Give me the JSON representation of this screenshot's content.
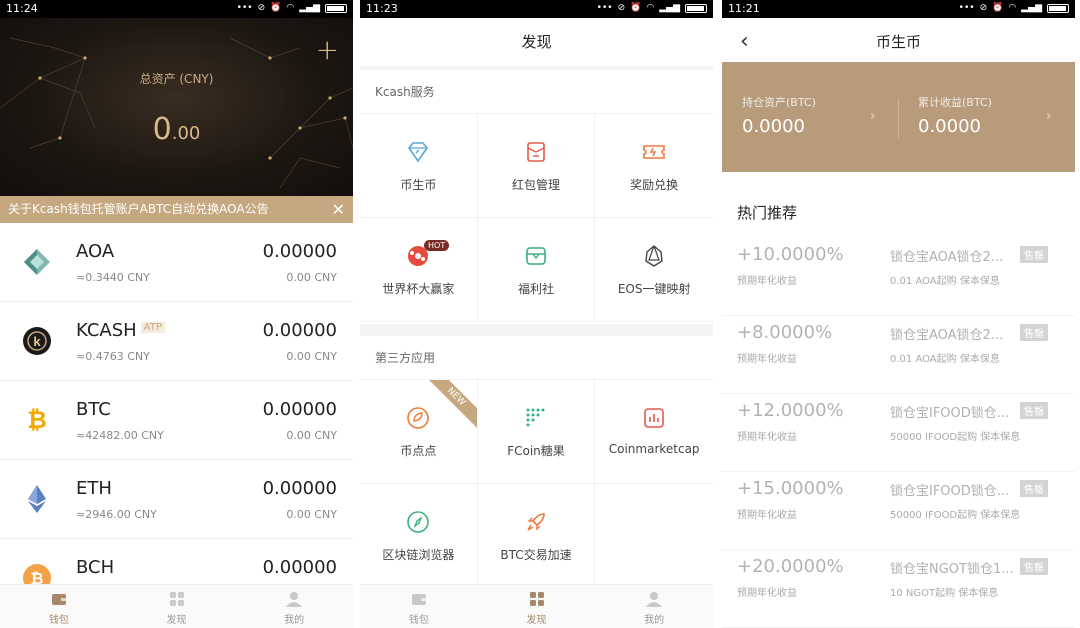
{
  "screen1": {
    "status_time": "11:24",
    "asset_label": "总资产 (CNY)",
    "asset_value_int": "0",
    "asset_value_dec": ".00",
    "notice": "关于Kcash钱包托管账户ABTC自动兑换AOA公告",
    "coins": [
      {
        "name": "AOA",
        "badge": "",
        "price": "≈0.3440 CNY",
        "amount": "0.00000",
        "cny": "0.00 CNY",
        "icon": "aoa-icon"
      },
      {
        "name": "KCASH",
        "badge": "ATP",
        "price": "≈0.4763 CNY",
        "amount": "0.00000",
        "cny": "0.00 CNY",
        "icon": "kcash-icon"
      },
      {
        "name": "BTC",
        "badge": "",
        "price": "≈42482.00 CNY",
        "amount": "0.00000",
        "cny": "0.00 CNY",
        "icon": "btc-icon"
      },
      {
        "name": "ETH",
        "badge": "",
        "price": "≈2946.00 CNY",
        "amount": "0.00000",
        "cny": "0.00 CNY",
        "icon": "eth-icon"
      },
      {
        "name": "BCH",
        "badge": "",
        "price": "",
        "amount": "0.00000",
        "cny": "",
        "icon": "bch-icon"
      }
    ],
    "tabs": [
      "钱包",
      "发现",
      "我的"
    ],
    "active_tab": 0
  },
  "screen2": {
    "status_time": "11:23",
    "title": "发现",
    "section1_title": "Kcash服务",
    "section1_items": [
      {
        "label": "币生币",
        "icon": "diamond-icon"
      },
      {
        "label": "红包管理",
        "icon": "red-envelope-icon"
      },
      {
        "label": "奖励兑换",
        "icon": "ticket-icon"
      },
      {
        "label": "世界杯大赢家",
        "icon": "soccer-ball-icon",
        "badge": "HOT"
      },
      {
        "label": "福利社",
        "icon": "gift-box-icon"
      },
      {
        "label": "EOS一键映射",
        "icon": "eos-icon"
      }
    ],
    "section2_title": "第三方应用",
    "section2_items": [
      {
        "label": "币点点",
        "icon": "coin-dot-icon",
        "ribbon": "NEW"
      },
      {
        "label": "FCoin糖果",
        "icon": "fcoin-icon"
      },
      {
        "label": "Coinmarketcap",
        "icon": "chart-icon"
      },
      {
        "label": "区块链浏览器",
        "icon": "compass-icon"
      },
      {
        "label": "BTC交易加速",
        "icon": "rocket-icon"
      }
    ],
    "tabs": [
      "钱包",
      "发现",
      "我的"
    ],
    "active_tab": 1
  },
  "screen3": {
    "status_time": "11:21",
    "title": "币生币",
    "holding_label": "持仓资产(BTC)",
    "holding_value": "0.0000",
    "earnings_label": "累计收益(BTC)",
    "earnings_value": "0.0000",
    "hot_title": "热门推荐",
    "rate_label": "预期年化收益",
    "sold_label": "售罄",
    "products": [
      {
        "rate": "+10.0000%",
        "name": "锁仓宝AOA锁仓2...",
        "desc": "0.01 AOA起购 保本保息"
      },
      {
        "rate": "+8.0000%",
        "name": "锁仓宝AOA锁仓2...",
        "desc": "0.01 AOA起购 保本保息"
      },
      {
        "rate": "+12.0000%",
        "name": "锁仓宝IFOOD锁仓...",
        "desc": "50000 IFOOD起购 保本保息"
      },
      {
        "rate": "+15.0000%",
        "name": "锁仓宝IFOOD锁仓...",
        "desc": "50000 IFOOD起购 保本保息"
      },
      {
        "rate": "+20.0000%",
        "name": "锁仓宝NGOT锁仓1...",
        "desc": "10 NGOT起购 保本保息"
      }
    ]
  },
  "colors": {
    "gold": "#c5a880",
    "summary_bg": "#b89b7a",
    "hero_dark": "#1d1712",
    "active_tab": "#a7896a"
  }
}
